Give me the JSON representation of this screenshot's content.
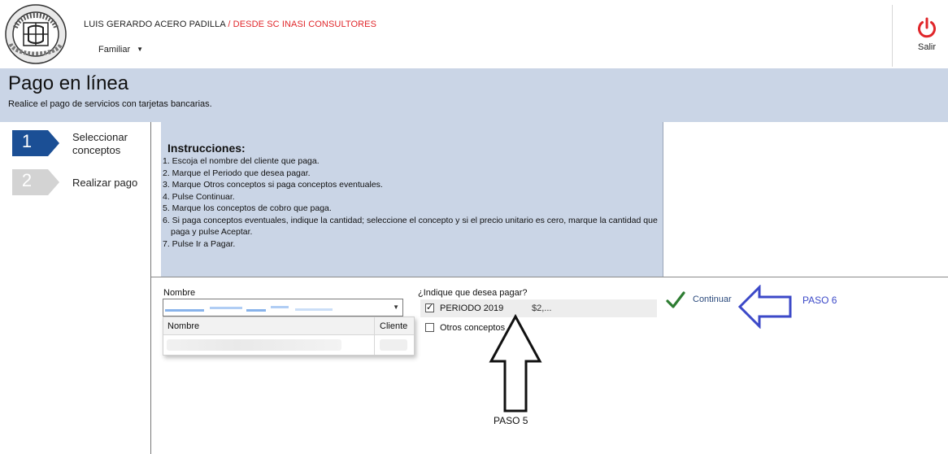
{
  "header": {
    "logo_text": "COLEGIO CERVANTES",
    "user_name": "LUIS GERARDO ACERO PADILLA",
    "user_org": " / DESDE SC INASI CONSULTORES",
    "profile": "Familiar",
    "logout_label": "Salir",
    "logout_color": "#e0262a"
  },
  "title_band": {
    "title": "Pago en línea",
    "subtitle": "Realice el pago de servicios con tarjetas bancarias."
  },
  "steps": [
    {
      "number": "1",
      "label": "Seleccionar conceptos",
      "active": true,
      "color": "#1b4f95"
    },
    {
      "number": "2",
      "label": "Realizar pago",
      "active": false,
      "color": "#d3d3d3"
    }
  ],
  "instructions": {
    "title": "Instrucciones:",
    "items": [
      "1. Escoja el nombre del cliente que paga.",
      "2. Marque el Periodo que desea pagar.",
      "3. Marque Otros conceptos si paga conceptos eventuales.",
      "4. Pulse Continuar.",
      "5. Marque los conceptos de cobro que paga.",
      "6. Si paga conceptos eventuales, indique la cantidad; seleccione el concepto y si el precio unitario es cero, marque la cantidad que paga y pulse Aceptar.",
      "7. Pulse Ir a Pagar."
    ]
  },
  "form": {
    "nombre_label": "Nombre",
    "dropdown_columns": {
      "nombre": "Nombre",
      "cliente": "Cliente"
    },
    "pagar_label": "¿Indique que desea pagar?",
    "periodo_label": "PERIODO 2019",
    "periodo_checked": true,
    "periodo_amount": "$2,...",
    "otros_label": "Otros conceptos",
    "otros_checked": false,
    "continuar_label": "Continuar",
    "accent": "#2e7d32"
  },
  "annotations": {
    "paso6": "PASO 6",
    "paso5": "PASO 5",
    "paso6_color": "#3c49c8"
  }
}
